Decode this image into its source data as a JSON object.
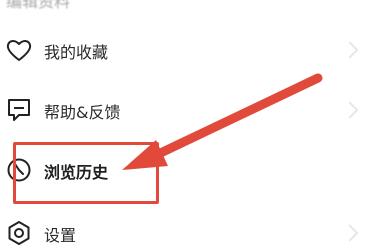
{
  "header": {
    "partial_title": "编辑资料"
  },
  "menu": {
    "items": [
      {
        "label": "我的收藏",
        "icon": "heart-icon"
      },
      {
        "label": "帮助&反馈",
        "icon": "message-square-icon"
      },
      {
        "label": "浏览历史",
        "icon": "clock-icon"
      },
      {
        "label": "设置",
        "icon": "gear-icon"
      }
    ]
  },
  "annotation": {
    "color": "#e14a3b",
    "target_label": "浏览历史"
  }
}
